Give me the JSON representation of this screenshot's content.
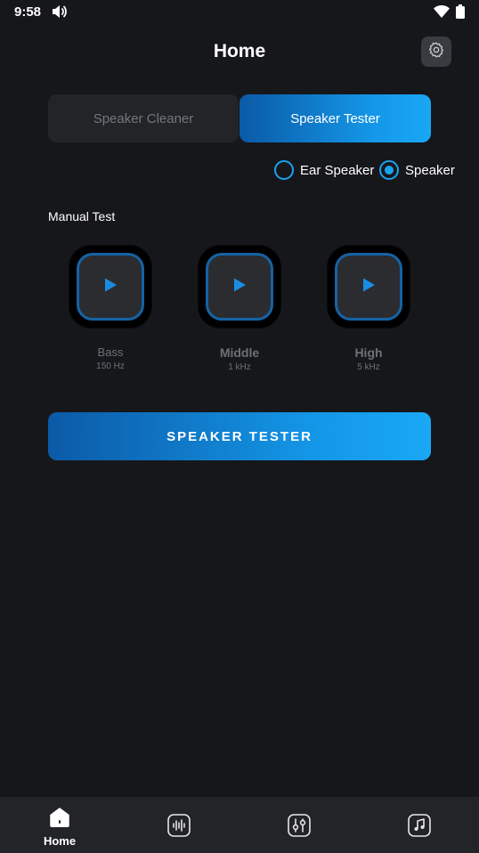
{
  "status_bar": {
    "time": "9:58"
  },
  "header": {
    "title": "Home"
  },
  "tabs": [
    {
      "label": "Speaker Cleaner",
      "active": false
    },
    {
      "label": "Speaker Tester",
      "active": true
    }
  ],
  "output_mode": {
    "options": [
      {
        "label": "Ear Speaker",
        "selected": false
      },
      {
        "label": "Speaker",
        "selected": true
      }
    ]
  },
  "manual_test": {
    "label": "Manual Test",
    "tiles": [
      {
        "name": "Bass",
        "freq": "150 Hz"
      },
      {
        "name": "Middle",
        "freq": "1 kHz"
      },
      {
        "name": "High",
        "freq": "5 kHz"
      }
    ]
  },
  "main_button": {
    "label": "SPEAKER TESTER"
  },
  "bottom_nav": {
    "items": [
      {
        "icon": "home-icon",
        "label": "Home",
        "active": true
      },
      {
        "icon": "waveform-icon"
      },
      {
        "icon": "equalizer-icon"
      },
      {
        "icon": "music-note-icon"
      }
    ]
  },
  "colors": {
    "background": "#16171b",
    "accent": "#1aa2ee",
    "panel": "#232428"
  }
}
